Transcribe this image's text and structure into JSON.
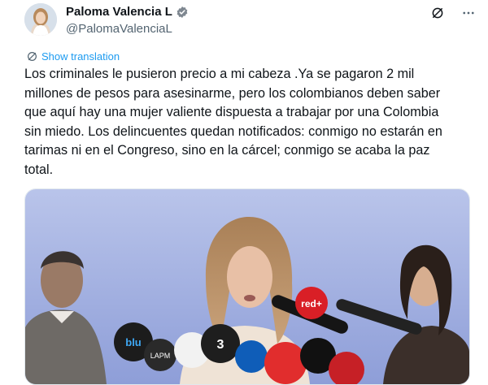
{
  "user": {
    "display_name": "Paloma Valencia L",
    "handle": "@PalomaValenciaL"
  },
  "icons": {
    "verified": "verified-badge-icon",
    "grok": "grok-icon",
    "more": "more-options-icon",
    "translate": "translate-icon"
  },
  "colors": {
    "accent": "#1d9bf0",
    "text": "#0f1419",
    "muted": "#536471"
  },
  "translate_label": "Show translation",
  "tweet_text": "Los criminales le pusieron precio a mi cabeza .Ya se pagaron 2 mil millones de pesos para asesinarme, pero los colombianos deben saber que aquí hay una mujer valiente dispuesta a trabajar por una Colombia sin miedo. Los delincuentes quedan notificados: conmigo no estarán en tarimas ni en el Congreso, sino en la cárcel; conmigo se acaba la paz total.",
  "media": {
    "mic_labels": [
      "blu",
      "LAPM",
      "red+",
      "3"
    ]
  }
}
